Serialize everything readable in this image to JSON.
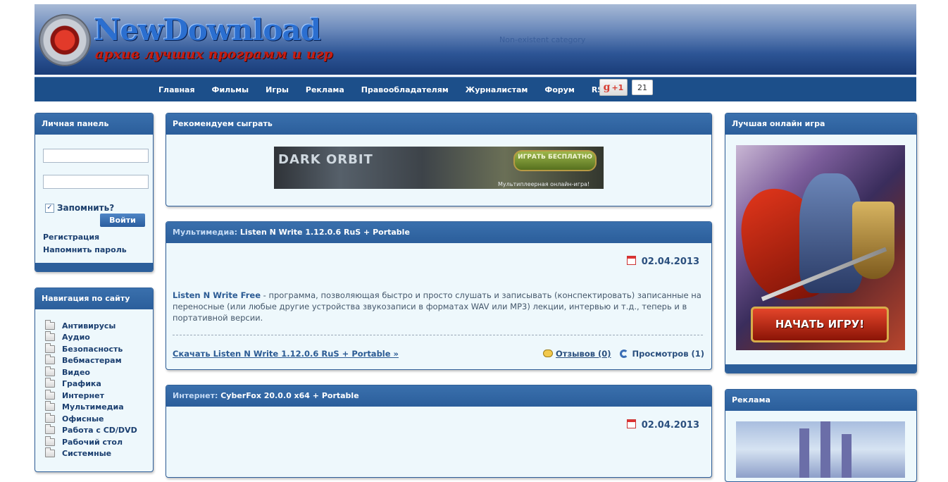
{
  "header": {
    "logo_title": "NewDownload",
    "logo_subtitle": "архив лучших программ и игр",
    "note": "Non-existent category"
  },
  "nav": {
    "items": [
      "Главная",
      "Фильмы",
      "Игры",
      "Реклама",
      "Правообладателям",
      "Журналистам",
      "Форум",
      "RSS 2.0"
    ],
    "gplus_label": "+1",
    "gplus_g": "g",
    "gplus_count": "21"
  },
  "login_panel": {
    "title": "Личная панель",
    "remember_label": "Запомнить?",
    "remember_checked": true,
    "login_button": "Войти",
    "register_link": "Регистрация",
    "remind_link": "Напомнить пароль"
  },
  "site_nav": {
    "title": "Навигация по сайту",
    "categories": [
      "Антивирусы",
      "Аудио",
      "Безопасность",
      "Вебмастерам",
      "Видео",
      "Графика",
      "Интернет",
      "Мультимедиа",
      "Офисные",
      "Работа с CD/DVD",
      "Рабочий стол",
      "Системные"
    ]
  },
  "recommend": {
    "title": "Рекомендуем сыграть",
    "banner_logo": "DARK ORBIT",
    "banner_button": "ИГРАТЬ БЕСПЛАТНО",
    "banner_caption": "Мультиплеерная онлайн-игра!"
  },
  "posts": [
    {
      "category": "Мультимедиа:",
      "title": "Listen N Write 1.12.0.6 RuS + Portable",
      "date": "02.04.2013",
      "text_strong": "Listen N Write Free",
      "text": " - программа, позволяющая быстро и просто слушать и записывать (конспектировать) записанные на переносные (или любые другие устройства звукозаписи в форматах WAV или MP3) лекции, интервью и т.д., теперь и в портативной версии.",
      "download_link": "Скачать Listen N Write 1.12.0.6 RuS + Portable »",
      "reviews": "Отзывов (0)",
      "views": "Просмотров (1)"
    },
    {
      "category": "Интернет:",
      "title": "CyberFox 20.0.0 x64 + Portable",
      "date": "02.04.2013",
      "text_strong": "",
      "text": "",
      "download_link": "",
      "reviews": "",
      "views": ""
    }
  ],
  "right_game": {
    "title": "Лучшая онлайн игра",
    "button": "НАЧАТЬ ИГРУ!"
  },
  "right_ad": {
    "title": "Реклама"
  },
  "colors": {
    "panel_header": "#2f66a4",
    "nav_bar": "#1c4f8a",
    "link": "#2b5b94",
    "panel_bg": "#eef8fc"
  }
}
